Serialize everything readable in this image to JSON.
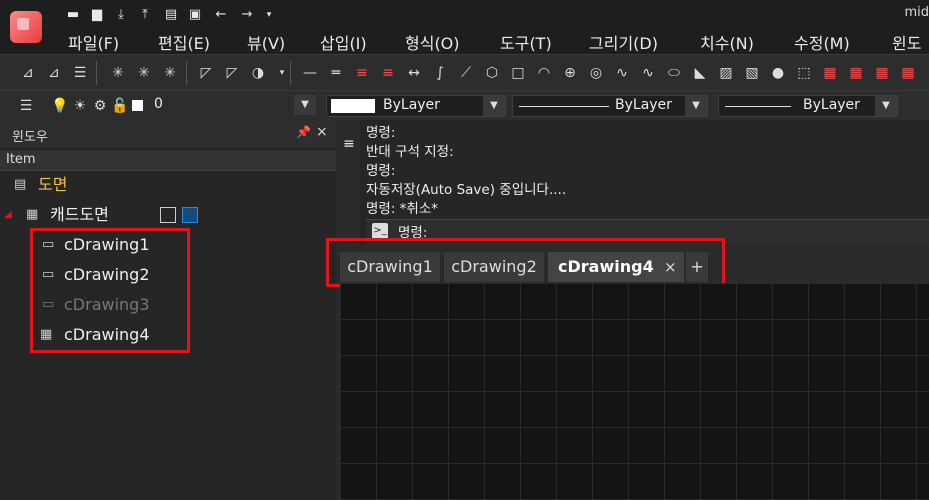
{
  "app": {
    "title_fragment": "mid"
  },
  "quick_access": [
    "new-file-icon",
    "open-folder-icon",
    "save-icon",
    "save-as-icon",
    "print-icon",
    "export-icon",
    "undo-icon",
    "redo-icon",
    "customize-icon"
  ],
  "menu": [
    {
      "label": "파일(F)"
    },
    {
      "label": "편집(E)"
    },
    {
      "label": "뷰(V)"
    },
    {
      "label": "삽입(I)"
    },
    {
      "label": "형식(O)"
    },
    {
      "label": "도구(T)"
    },
    {
      "label": "그리기(D)"
    },
    {
      "label": "치수(N)"
    },
    {
      "label": "수정(M)"
    },
    {
      "label": "윈도"
    }
  ],
  "toolbar2": {
    "layer_value": "0",
    "color_value": "ByLayer",
    "linetype_value": "ByLayer",
    "lineweight_value": "ByLayer"
  },
  "panel": {
    "title": "윈도우",
    "column_header": "Item",
    "root_label": "도면",
    "cad_node_label": "캐드도면",
    "items": [
      {
        "label": "cDrawing1",
        "state": "normal"
      },
      {
        "label": "cDrawing2",
        "state": "normal"
      },
      {
        "label": "cDrawing3",
        "state": "disabled"
      },
      {
        "label": "cDrawing4",
        "state": "active"
      }
    ]
  },
  "command": {
    "lines": [
      "명령:",
      "반대 구석 지정:",
      "명령:",
      "자동저장(Auto Save) 중입니다....",
      "명령:  *취소*"
    ],
    "prompt_label": "명령:"
  },
  "tabs": [
    {
      "label": "cDrawing1",
      "active": false
    },
    {
      "label": "cDrawing2",
      "active": false
    },
    {
      "label": "cDrawing4",
      "active": true
    }
  ],
  "tab_close_glyph": "×",
  "tab_add_glyph": "+",
  "colors": {
    "accent_red": "#e0141a",
    "root_label": "#f0c040",
    "disabled_text": "#777777"
  }
}
